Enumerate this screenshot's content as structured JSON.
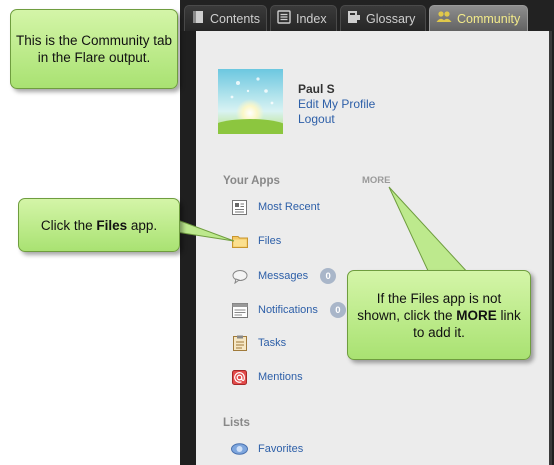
{
  "tabs": [
    {
      "label": "Contents",
      "icon": "contents-icon"
    },
    {
      "label": "Index",
      "icon": "index-icon"
    },
    {
      "label": "Glossary",
      "icon": "glossary-icon"
    },
    {
      "label": "Community",
      "icon": "community-icon",
      "active": true
    }
  ],
  "profile": {
    "name": "Paul S",
    "edit_label": "Edit My Profile",
    "logout_label": "Logout"
  },
  "apps_section": {
    "heading": "Your Apps",
    "more_label": "MORE",
    "items": [
      {
        "label": "Most Recent",
        "icon": "recent-icon"
      },
      {
        "label": "Files",
        "icon": "folder-icon"
      },
      {
        "label": "Messages",
        "icon": "speech-bubble-icon",
        "badge": "0"
      },
      {
        "label": "Notifications",
        "icon": "notifications-icon",
        "badge": "0"
      },
      {
        "label": "Tasks",
        "icon": "clipboard-icon"
      },
      {
        "label": "Mentions",
        "icon": "at-sign-icon"
      }
    ]
  },
  "lists_section": {
    "heading": "Lists",
    "items": [
      {
        "label": "Favorites",
        "icon": "favorites-icon"
      }
    ]
  },
  "callouts": {
    "top": "This is the Community tab in the Flare output.",
    "files_prefix": "Click the ",
    "files_bold": "Files",
    "files_suffix": " app.",
    "more_prefix": "If the Files app is not shown, click the ",
    "more_bold": "MORE",
    "more_suffix": " link to add it."
  },
  "colors": {
    "callout_green": "#b9ea86",
    "link_blue": "#2d5fa8",
    "active_tab_text": "#f2ea8a"
  }
}
